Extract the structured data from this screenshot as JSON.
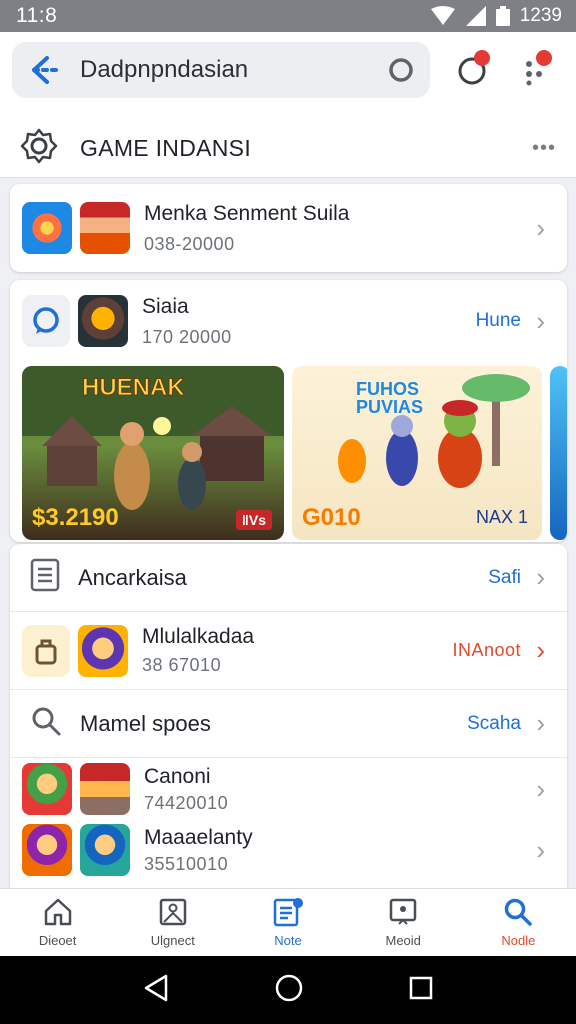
{
  "status_bar": {
    "time": "11:8",
    "battery_text": "1239"
  },
  "search": {
    "text": "Dadpnpndasian"
  },
  "header": {
    "title": "GAME INDANSI"
  },
  "featured": {
    "title": "Menka Senment Suila",
    "subtitle": "038-20000"
  },
  "section": {
    "title": "Siaia",
    "subtitle": "170 20000",
    "link": "Hune",
    "banners": [
      {
        "title": "HUENAK",
        "price": "$3.2190",
        "tag": "ǁVs"
      },
      {
        "title": "FUHOS PUVIAS",
        "price": "G010",
        "tag": "NAX 1"
      }
    ]
  },
  "list": [
    {
      "title": "Ancarkaisa",
      "link": "Safi"
    },
    {
      "title": "Mlulalkadaa",
      "subtitle": "38 67010",
      "link": "INAnoot"
    },
    {
      "title": "Mamel spoes",
      "link": "Scaha"
    },
    {
      "title": "Canoni",
      "subtitle": "74420010"
    },
    {
      "title": "Maaaelanty",
      "subtitle": "35510010"
    }
  ],
  "bottom_nav": [
    {
      "label": "Dieoet",
      "icon": "home-icon"
    },
    {
      "label": "Ulgnect",
      "icon": "image-icon"
    },
    {
      "label": "Note",
      "icon": "document-icon"
    },
    {
      "label": "Meoid",
      "icon": "screen-icon"
    },
    {
      "label": "Nodle",
      "icon": "search-icon"
    }
  ],
  "colors": {
    "accent_blue": "#1e6fd9",
    "accent_red": "#e24a2b",
    "badge_red": "#e53935"
  }
}
